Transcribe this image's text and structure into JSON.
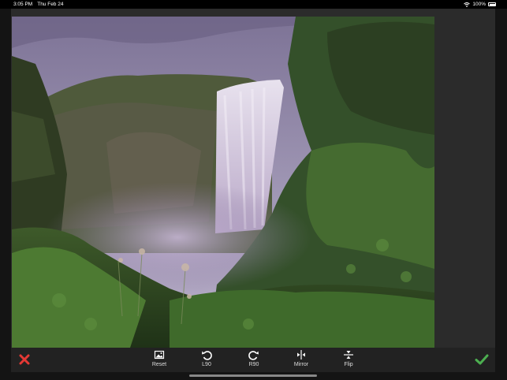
{
  "status": {
    "time": "3:05 PM",
    "date": "Thu Feb 24",
    "battery": "100%"
  },
  "toolbar": {
    "reset": "Reset",
    "l90": "L90",
    "r90": "R90",
    "mirror": "Mirror",
    "flip": "Flip"
  },
  "colors": {
    "cancel": "#e53935",
    "confirm": "#4caf50"
  }
}
